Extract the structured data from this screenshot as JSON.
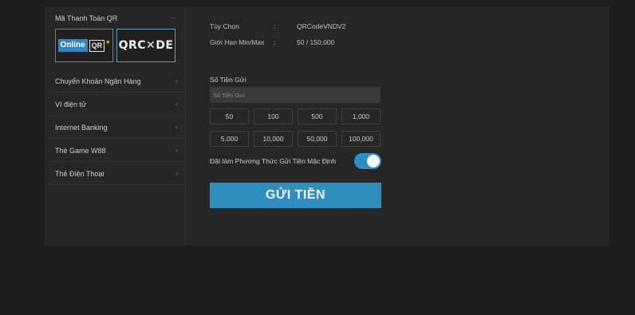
{
  "sidebar": {
    "qr_header": "Mã Thanh Toán QR",
    "qr_collapse": "−",
    "logos": {
      "online_text": "Online",
      "online_qr": "QR",
      "qrcode_text": "QRC✕DE"
    },
    "items": [
      {
        "label": "Chuyển Khoản Ngân Hàng",
        "chevron": "+"
      },
      {
        "label": "Ví điện tử",
        "chevron": "+"
      },
      {
        "label": "Internet Banking",
        "chevron": "+"
      },
      {
        "label": "Thẻ Game W88",
        "chevron": "+"
      },
      {
        "label": "Thẻ Điện Thoại",
        "chevron": "+"
      }
    ]
  },
  "info": {
    "option_label": "Tùy Chọn",
    "option_sep": ":",
    "option_value": "QRCodeVNDV2",
    "limit_label": "Giới Hạn Min/Max",
    "limit_sep": ":",
    "limit_value": "50 / 150,000"
  },
  "amount": {
    "label": "Số Tiền Gửi",
    "placeholder": "Số Tiền Gửi",
    "presets": [
      "50",
      "100",
      "500",
      "1,000",
      "5,000",
      "10,000",
      "50,000",
      "100,000"
    ]
  },
  "default_method": {
    "label": "Đặt làm Phương Thức Gửi Tiền Mặc Định",
    "enabled": true
  },
  "submit_label": "GỬI TIỀN",
  "colors": {
    "accent": "#2f8fbe",
    "toggle_on": "#2a8fc8",
    "online_blue": "#2f86c4",
    "panel_bg": "#262626",
    "page_bg": "#1d1d1e"
  }
}
